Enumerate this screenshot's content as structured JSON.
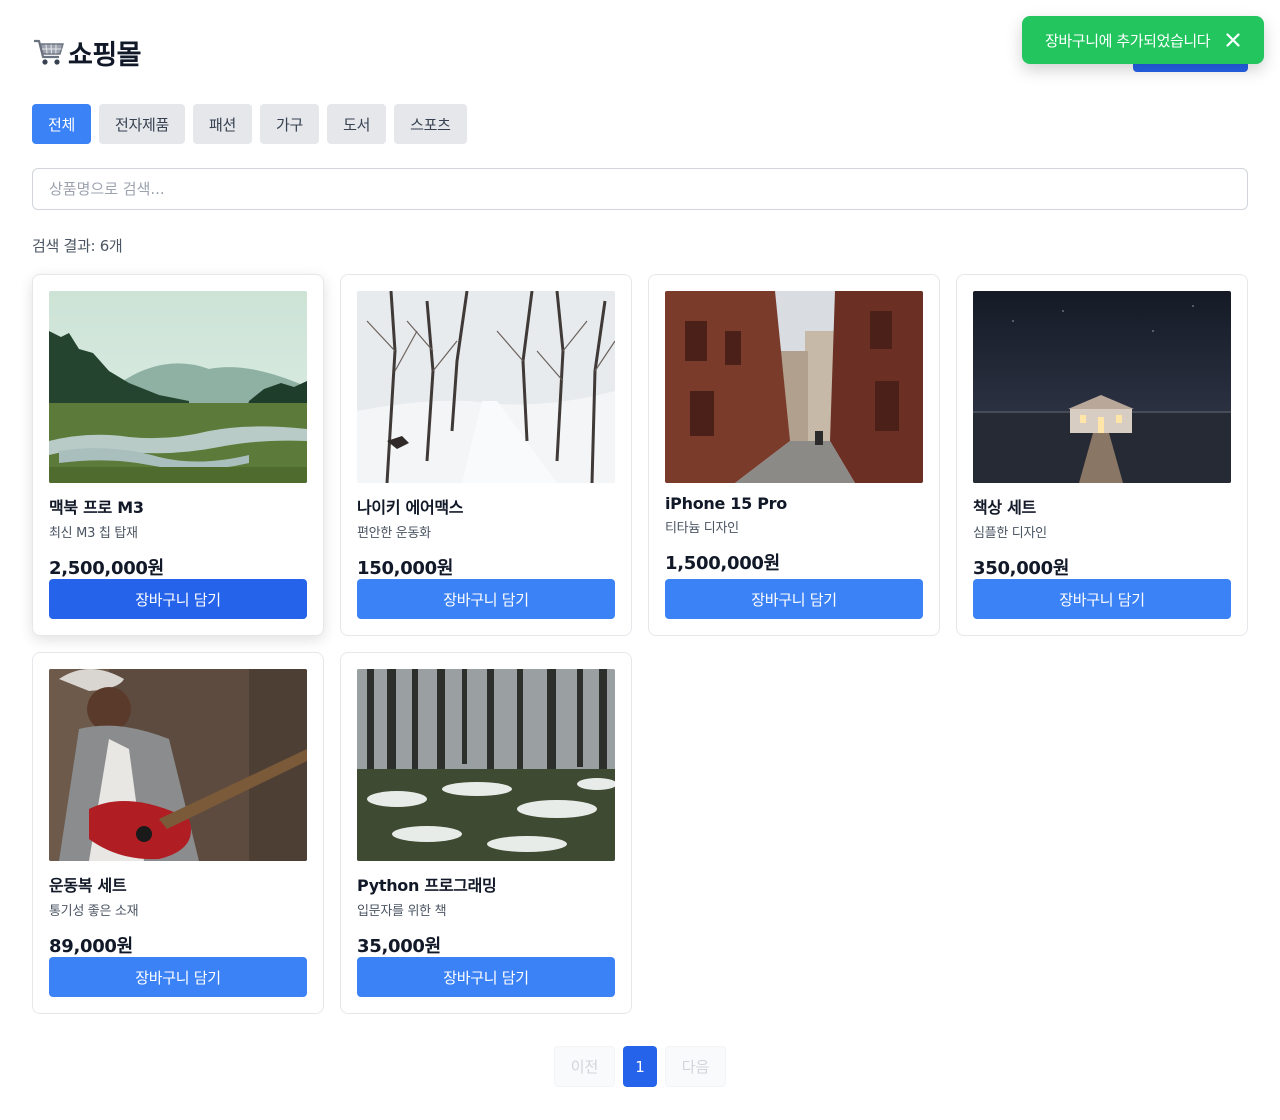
{
  "header": {
    "title": "쇼핑몰",
    "cart_icon": "shopping-cart-icon"
  },
  "toast": {
    "message": "장바구니에 추가되었습니다",
    "close_icon": "close-icon",
    "color": "#22c55e"
  },
  "tabs": [
    {
      "label": "전체",
      "active": true
    },
    {
      "label": "전자제품",
      "active": false
    },
    {
      "label": "패션",
      "active": false
    },
    {
      "label": "가구",
      "active": false
    },
    {
      "label": "도서",
      "active": false
    },
    {
      "label": "스포츠",
      "active": false
    }
  ],
  "search": {
    "placeholder": "상품명으로 검색...",
    "value": ""
  },
  "results": {
    "label": "검색 결과: 6개"
  },
  "products": [
    {
      "name": "맥북 프로 M3",
      "description": "최신 M3 칩 탑재",
      "price": "2,500,000원",
      "button": "장바구니 담기",
      "image": "mountain-lake-landscape"
    },
    {
      "name": "나이키 에어맥스",
      "description": "편안한 운동화",
      "price": "150,000원",
      "button": "장바구니 담기",
      "image": "snowy-tree-road"
    },
    {
      "name": "iPhone 15 Pro",
      "description": "티타늄 디자인",
      "price": "1,500,000원",
      "button": "장바구니 담기",
      "image": "brick-alley-street"
    },
    {
      "name": "책상 세트",
      "description": "심플한 디자인",
      "price": "350,000원",
      "button": "장바구니 담기",
      "image": "boathouse-night"
    },
    {
      "name": "운동복 세트",
      "description": "통기성 좋은 소재",
      "price": "89,000원",
      "button": "장바구니 담기",
      "image": "woman-playing-guitar"
    },
    {
      "name": "Python 프로그래밍",
      "description": "입문자를 위한 책",
      "price": "35,000원",
      "button": "장바구니 담기",
      "image": "snowy-forest"
    }
  ],
  "pagination": {
    "prev": "이전",
    "current": "1",
    "next": "다음"
  },
  "colors": {
    "primary": "#3b82f6",
    "primary_dark": "#2563eb",
    "success": "#22c55e"
  }
}
